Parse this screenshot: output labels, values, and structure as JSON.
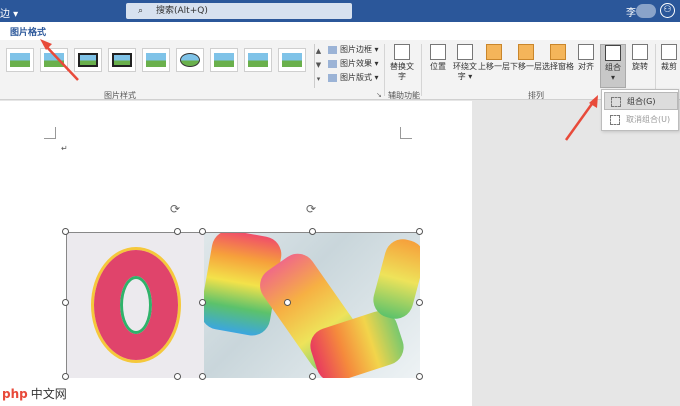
{
  "titlebar": {
    "left_fragment": "边 ▾",
    "search_placeholder": "搜索(Alt+Q)",
    "user_initial": "李",
    "avatar_glyph": "⚇"
  },
  "tabs": {
    "active": "图片格式"
  },
  "ribbon": {
    "styles_group_label": "图片样式",
    "small_cmds": [
      "图片边框 ▾",
      "图片效果 ▾",
      "图片版式 ▾"
    ],
    "alt_text": "替换文字",
    "accessibility_label": "辅助功能",
    "arrange_label": "排列",
    "buttons": {
      "position": "位置",
      "wrap_text_1": "环绕文",
      "wrap_text_2": "字 ▾",
      "bring_forward": "上移一层",
      "send_backward": "下移一层",
      "selection_pane": "选择窗格",
      "align": "对齐",
      "group": "组合",
      "rotate": "旋转",
      "crop": "裁剪"
    }
  },
  "context_menu": {
    "group": "组合(G)",
    "ungroup": "取消组合(U)"
  },
  "watermark": {
    "brand": "php",
    "cn": "中文网"
  },
  "colors": {
    "accent": "#2b579a",
    "arrow": "#e84a3a"
  }
}
